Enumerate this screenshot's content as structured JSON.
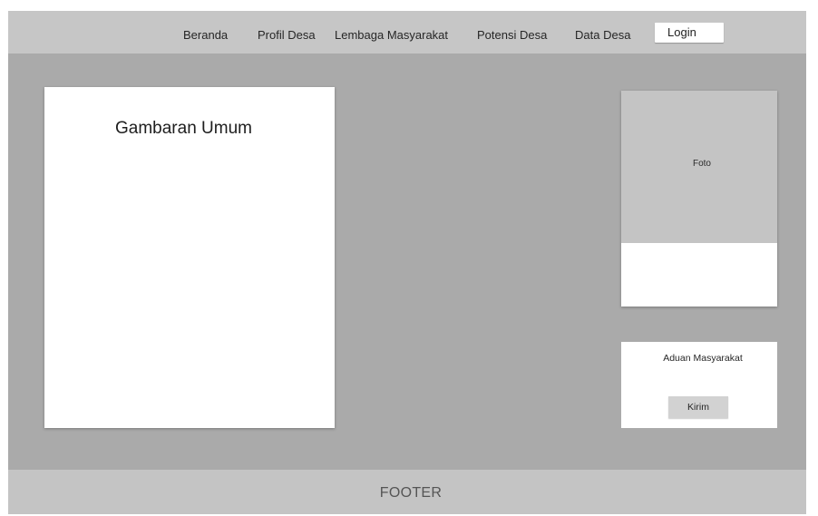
{
  "nav": {
    "items": [
      {
        "label": "Beranda"
      },
      {
        "label": "Profil Desa"
      },
      {
        "label": "Lembaga Masyarakat"
      },
      {
        "label": "Potensi Desa"
      },
      {
        "label": "Data Desa"
      }
    ],
    "login_label": "Login"
  },
  "main": {
    "title": "Gambaran Umum"
  },
  "photo": {
    "label": "Foto"
  },
  "complaint": {
    "title": "Aduan Masyarakat",
    "button_label": "Kirim"
  },
  "footer": {
    "text": "FOOTER"
  }
}
